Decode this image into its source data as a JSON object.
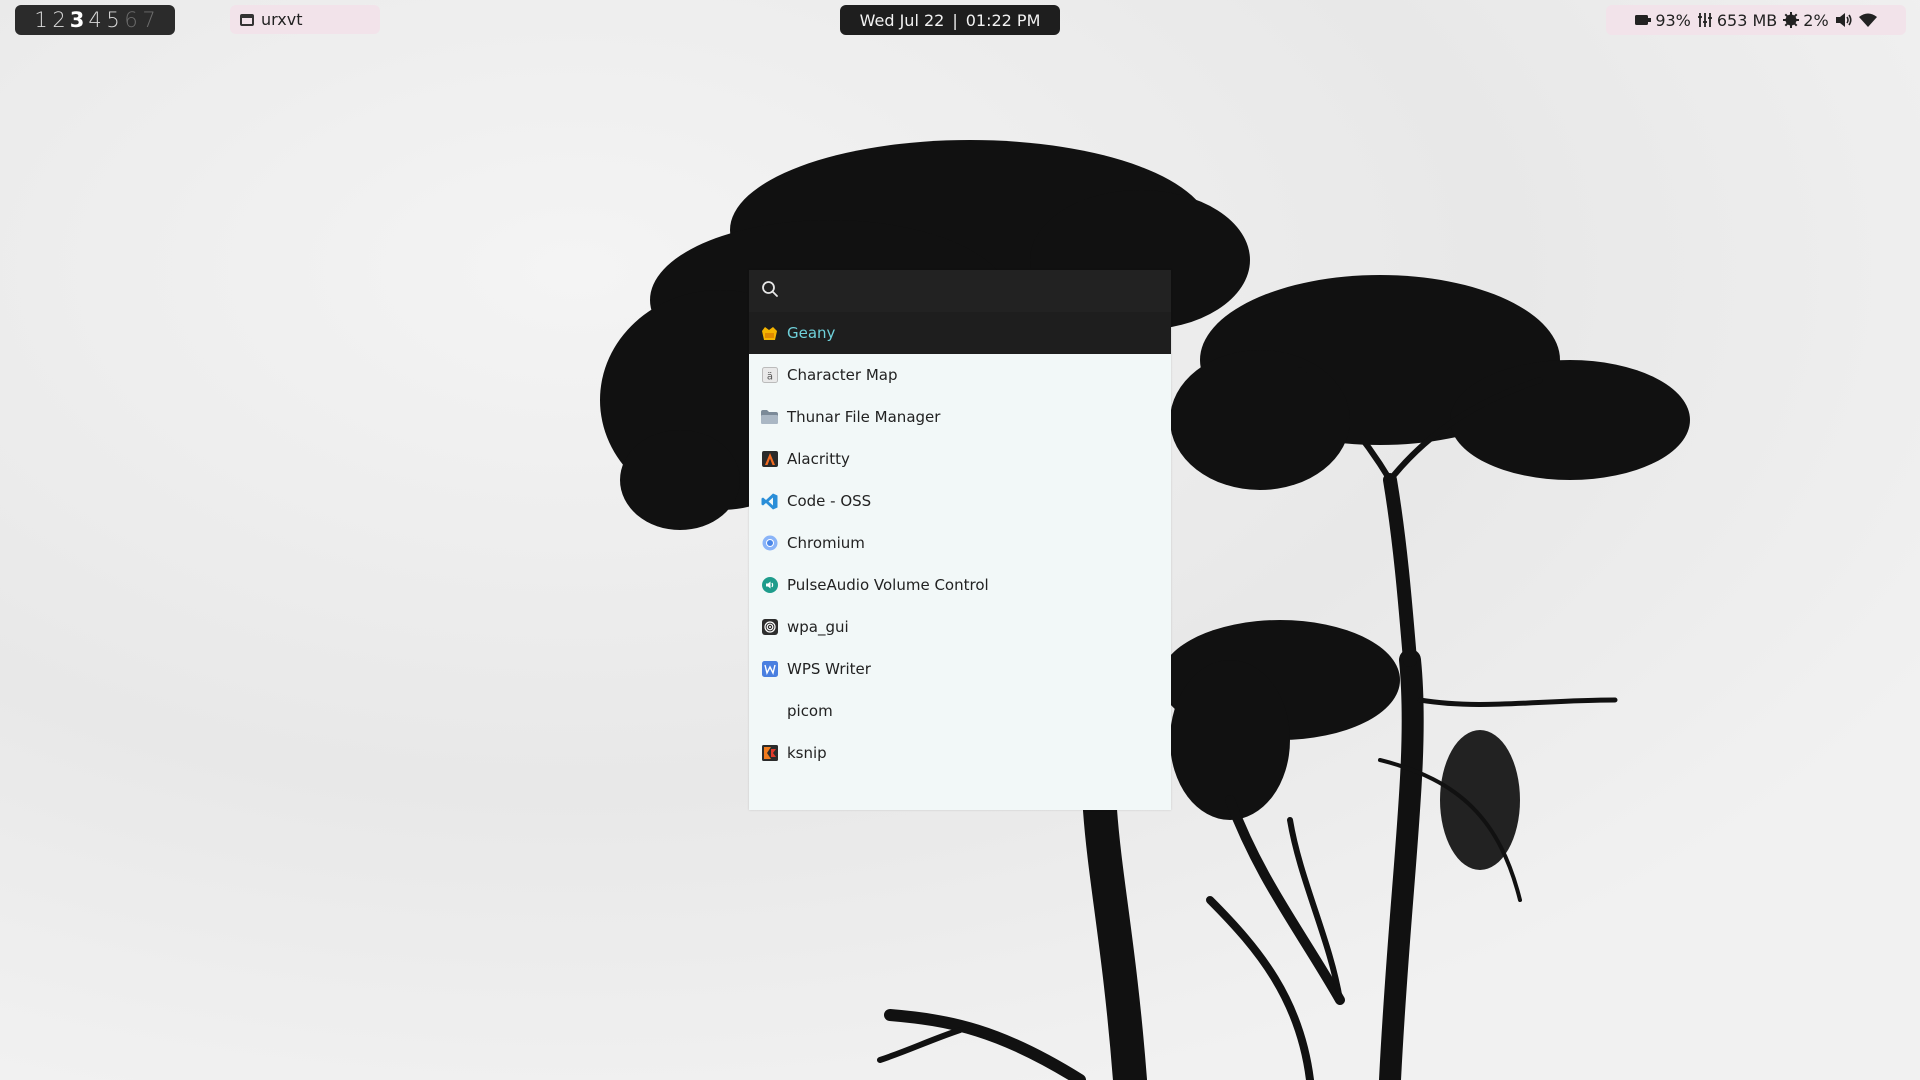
{
  "topbar": {
    "workspaces": [
      {
        "label": "1",
        "state": "normal"
      },
      {
        "label": "2",
        "state": "normal"
      },
      {
        "label": "3",
        "state": "active"
      },
      {
        "label": "4",
        "state": "normal"
      },
      {
        "label": "5",
        "state": "normal"
      },
      {
        "label": "6",
        "state": "dim"
      },
      {
        "label": "7",
        "state": "dim"
      }
    ],
    "task": {
      "label": "urxvt",
      "icon": "window-icon"
    },
    "clock": {
      "date": "Wed Jul 22",
      "separator": "|",
      "time": "01:22 PM"
    },
    "status": {
      "battery": {
        "icon": "battery-icon",
        "value": "93%"
      },
      "memory": {
        "icon": "memory-icon",
        "value": "653 MB"
      },
      "cpu": {
        "icon": "cpu-icon",
        "value": "2%"
      },
      "volume": {
        "icon": "volume-icon"
      },
      "wifi": {
        "icon": "wifi-icon"
      }
    }
  },
  "launcher": {
    "search": {
      "icon": "search-icon",
      "value": "",
      "placeholder": ""
    },
    "apps": [
      {
        "label": "Geany",
        "icon": "geany-icon",
        "selected": true
      },
      {
        "label": "Character Map",
        "icon": "character-map-icon"
      },
      {
        "label": "Thunar File Manager",
        "icon": "folder-icon"
      },
      {
        "label": "Alacritty",
        "icon": "alacritty-icon"
      },
      {
        "label": "Code - OSS",
        "icon": "vscode-icon"
      },
      {
        "label": "Chromium",
        "icon": "chromium-icon"
      },
      {
        "label": "PulseAudio Volume Control",
        "icon": "pulseaudio-icon"
      },
      {
        "label": "wpa_gui",
        "icon": "wpa-gui-icon"
      },
      {
        "label": "WPS Writer",
        "icon": "wps-writer-icon"
      },
      {
        "label": "picom",
        "icon": ""
      },
      {
        "label": "ksnip",
        "icon": "ksnip-icon"
      }
    ]
  },
  "colors": {
    "bar_dark": "#1e1e1e",
    "bar_light": "#f2e3ea",
    "launcher_bg": "#f2f8f8",
    "selected_text": "#6fd1da"
  }
}
